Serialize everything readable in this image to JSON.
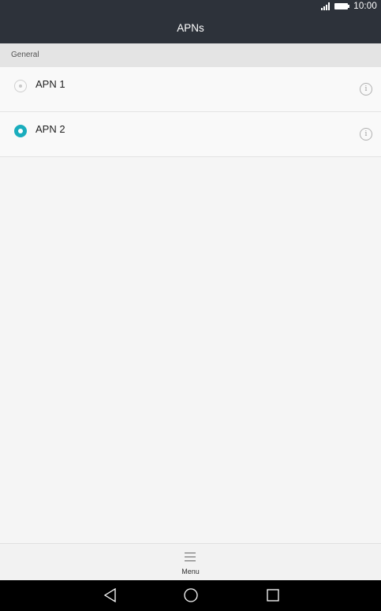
{
  "status_bar": {
    "time": "10:00"
  },
  "header": {
    "title": "APNs"
  },
  "section": {
    "label": "General"
  },
  "apns": [
    {
      "label": "APN 1",
      "selected": false
    },
    {
      "label": "APN 2",
      "selected": true
    }
  ],
  "bottom_menu": {
    "label": "Menu"
  },
  "colors": {
    "header_bg": "#2d323a",
    "accent": "#1aadbd",
    "nav_bg": "#000000"
  },
  "icons": [
    "signal-icon",
    "battery-icon",
    "radio-unselected-icon",
    "radio-selected-icon",
    "info-icon",
    "menu-icon",
    "back-icon",
    "home-icon",
    "recent-apps-icon"
  ]
}
